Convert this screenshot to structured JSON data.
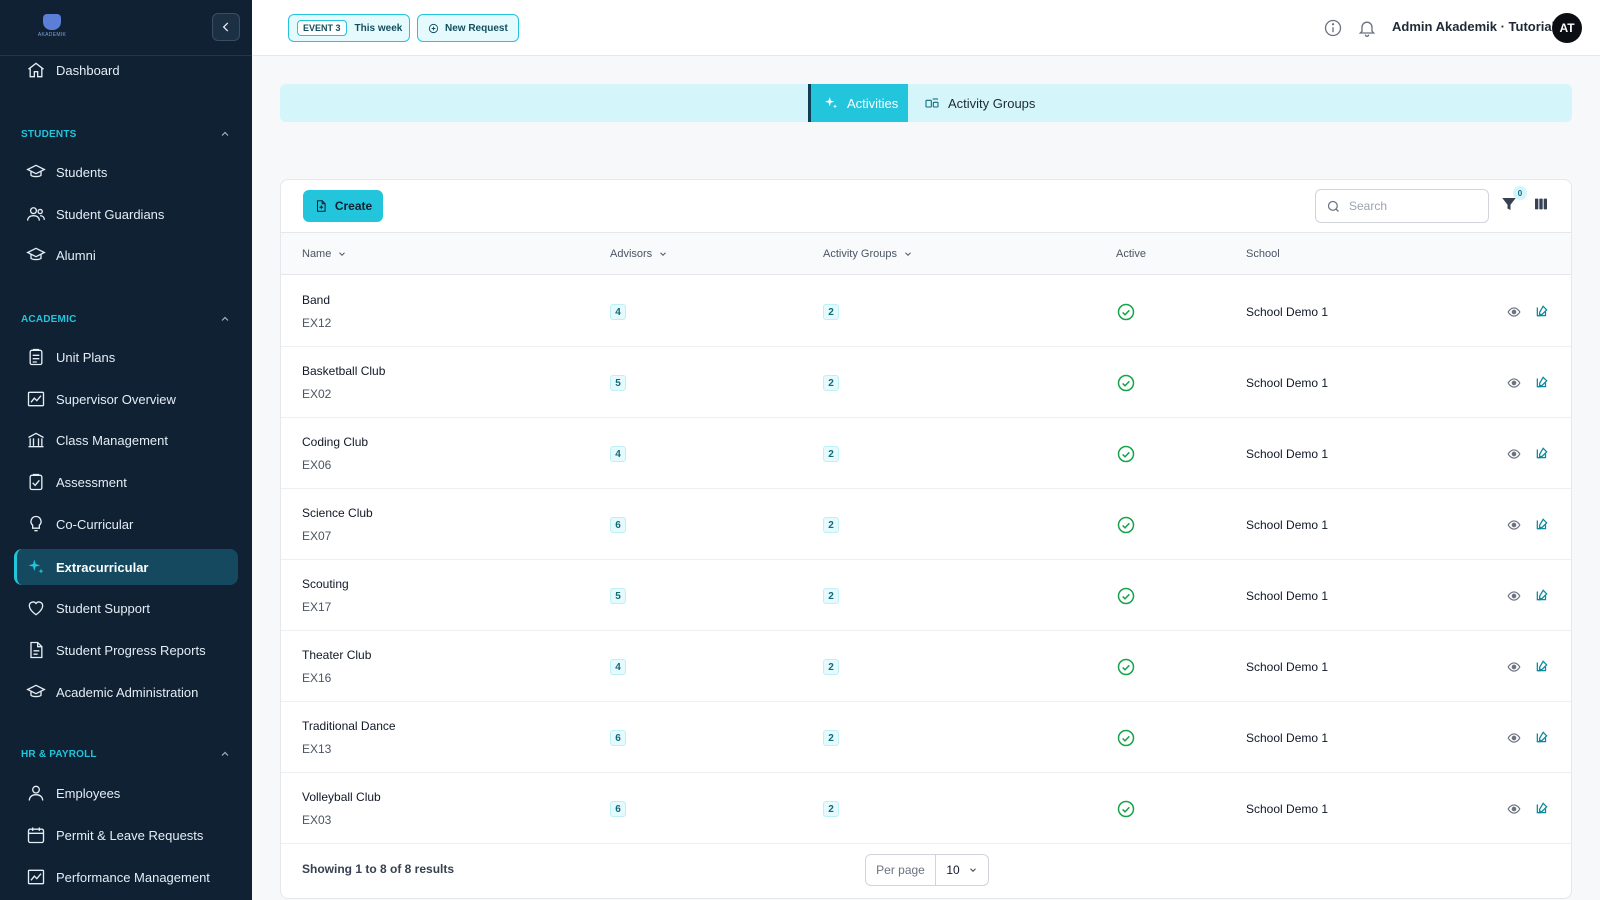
{
  "sidebar": {
    "logo_text": "AKADEMIK",
    "items_top": [
      {
        "label": "Dashboard",
        "icon": "home-icon"
      }
    ],
    "sections": [
      {
        "title": "STUDENTS",
        "items": [
          {
            "label": "Students",
            "icon": "graduation-cap-icon"
          },
          {
            "label": "Student Guardians",
            "icon": "users-icon"
          },
          {
            "label": "Alumni",
            "icon": "graduation-cap-icon"
          }
        ]
      },
      {
        "title": "ACADEMIC",
        "items": [
          {
            "label": "Unit Plans",
            "icon": "clipboard-icon"
          },
          {
            "label": "Supervisor Overview",
            "icon": "chart-line-icon"
          },
          {
            "label": "Class Management",
            "icon": "building-icon"
          },
          {
            "label": "Assessment",
            "icon": "clipboard-check-icon"
          },
          {
            "label": "Co-Curricular",
            "icon": "lightbulb-icon"
          },
          {
            "label": "Extracurricular",
            "icon": "sparkles-icon",
            "active": true
          },
          {
            "label": "Student Support",
            "icon": "heart-icon"
          },
          {
            "label": "Student Progress Reports",
            "icon": "document-icon"
          },
          {
            "label": "Academic Administration",
            "icon": "graduation-cap-icon"
          }
        ]
      },
      {
        "title": "HR & PAYROLL",
        "items": [
          {
            "label": "Employees",
            "icon": "user-icon"
          },
          {
            "label": "Permit & Leave Requests",
            "icon": "calendar-icon"
          },
          {
            "label": "Performance Management",
            "icon": "chart-line-icon"
          }
        ]
      }
    ]
  },
  "topbar": {
    "event_tag": "EVENT 3",
    "event_label": "This week",
    "new_request": "New Request",
    "user_name": "Admin Akademik · Tutorial",
    "avatar_initials": "AT"
  },
  "tabs": [
    {
      "label": "Activities",
      "icon": "sparkles-icon",
      "active": true
    },
    {
      "label": "Activity Groups",
      "icon": "group-icon",
      "active": false
    }
  ],
  "toolbar": {
    "create_label": "Create",
    "search_placeholder": "Search",
    "filter_count": "0"
  },
  "table": {
    "columns": [
      "Name",
      "Advisors",
      "Activity Groups",
      "Active",
      "School"
    ],
    "rows": [
      {
        "name": "Band",
        "code": "EX12",
        "advisors": "4",
        "groups": "2",
        "school": "School Demo 1"
      },
      {
        "name": "Basketball Club",
        "code": "EX02",
        "advisors": "5",
        "groups": "2",
        "school": "School Demo 1"
      },
      {
        "name": "Coding Club",
        "code": "EX06",
        "advisors": "4",
        "groups": "2",
        "school": "School Demo 1"
      },
      {
        "name": "Science Club",
        "code": "EX07",
        "advisors": "6",
        "groups": "2",
        "school": "School Demo 1"
      },
      {
        "name": "Scouting",
        "code": "EX17",
        "advisors": "5",
        "groups": "2",
        "school": "School Demo 1"
      },
      {
        "name": "Theater Club",
        "code": "EX16",
        "advisors": "4",
        "groups": "2",
        "school": "School Demo 1"
      },
      {
        "name": "Traditional Dance",
        "code": "EX13",
        "advisors": "6",
        "groups": "2",
        "school": "School Demo 1"
      },
      {
        "name": "Volleyball Club",
        "code": "EX03",
        "advisors": "6",
        "groups": "2",
        "school": "School Demo 1"
      }
    ]
  },
  "footer": {
    "showing": "Showing 1 to 8 of 8 results",
    "per_page_label": "Per page",
    "per_page_value": "10"
  },
  "colors": {
    "accent": "#22c5dc",
    "sidebar_bg": "#0f2133",
    "success": "#16a34a"
  }
}
